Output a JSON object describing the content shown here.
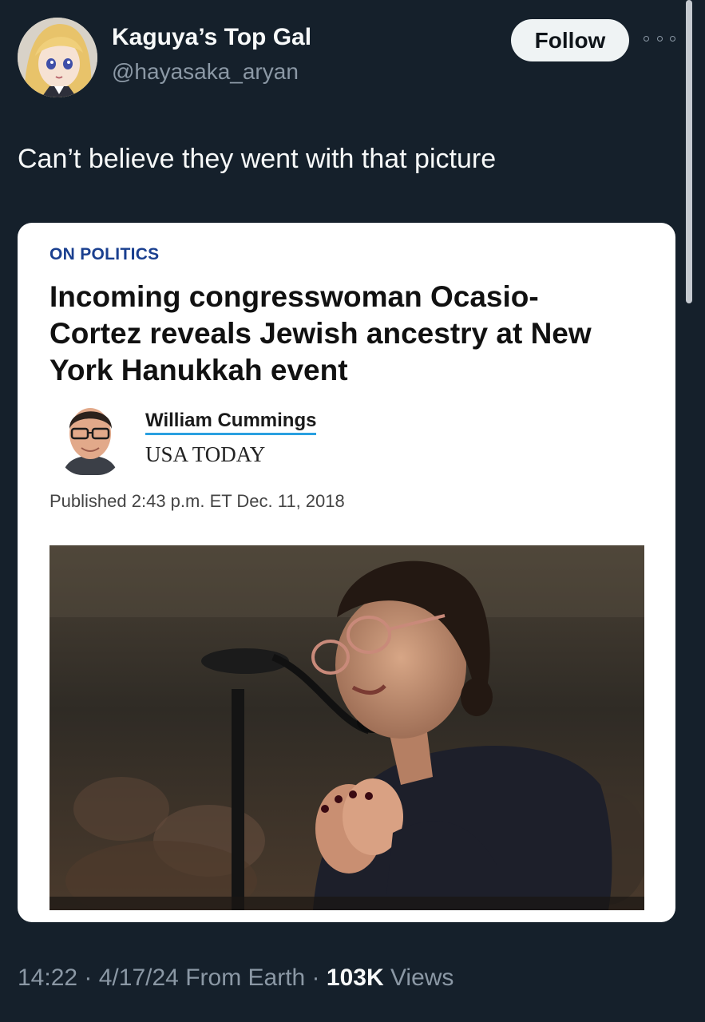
{
  "user": {
    "display_name": "Kaguya’s Top Gal",
    "handle": "@hayasaka_aryan",
    "follow_label": "Follow"
  },
  "tweet": {
    "text": "Can’t believe they went with that picture",
    "time": "14:22",
    "separator": " · ",
    "date": "4/17/24",
    "source": "From Earth",
    "views_count": "103K",
    "views_label": " Views"
  },
  "article": {
    "section": "ON POLITICS",
    "headline": "Incoming congresswoman Ocasio-Cortez reveals Jewish ancestry at New York Hanukkah event",
    "author": "William Cummings",
    "publication": "USA TODAY",
    "published": "Published 2:43 p.m. ET Dec. 11, 2018"
  },
  "colors": {
    "background": "#15202b",
    "section_label": "#1a3f8f",
    "author_underline": "#2aa0e0",
    "muted_text": "#8b98a5"
  },
  "icons": {
    "more": "more-horizontal-icon"
  }
}
